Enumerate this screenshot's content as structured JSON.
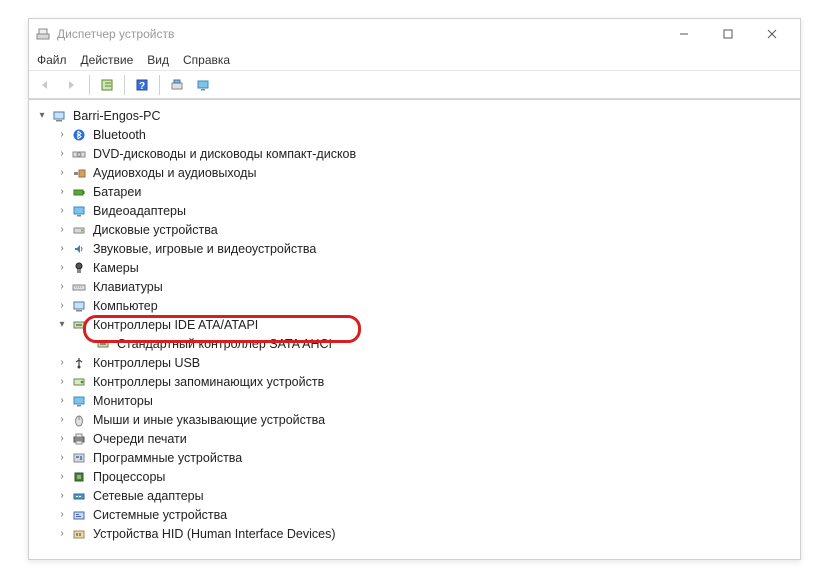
{
  "window": {
    "title": "Диспетчер устройств"
  },
  "menu": {
    "file": "Файл",
    "action": "Действие",
    "view": "Вид",
    "help": "Справка"
  },
  "tree": {
    "root": "Barri-Engos-PC",
    "items": [
      {
        "label": "Bluetooth"
      },
      {
        "label": "DVD-дисководы и дисководы компакт-дисков"
      },
      {
        "label": "Аудиовходы и аудиовыходы"
      },
      {
        "label": "Батареи"
      },
      {
        "label": "Видеоадаптеры"
      },
      {
        "label": "Дисковые устройства"
      },
      {
        "label": "Звуковые, игровые и видеоустройства"
      },
      {
        "label": "Камеры"
      },
      {
        "label": "Клавиатуры"
      },
      {
        "label": "Компьютер"
      },
      {
        "label": "Контроллеры IDE ATA/ATAPI",
        "expanded": true,
        "children": [
          {
            "label": "Стандартный контроллер SATA AHCI",
            "highlighted": true
          }
        ]
      },
      {
        "label": "Контроллеры USB"
      },
      {
        "label": "Контроллеры запоминающих устройств"
      },
      {
        "label": "Мониторы"
      },
      {
        "label": "Мыши и иные указывающие устройства"
      },
      {
        "label": "Очереди печати"
      },
      {
        "label": "Программные устройства"
      },
      {
        "label": "Процессоры"
      },
      {
        "label": "Сетевые адаптеры"
      },
      {
        "label": "Системные устройства"
      },
      {
        "label": "Устройства HID (Human Interface Devices)"
      }
    ]
  }
}
